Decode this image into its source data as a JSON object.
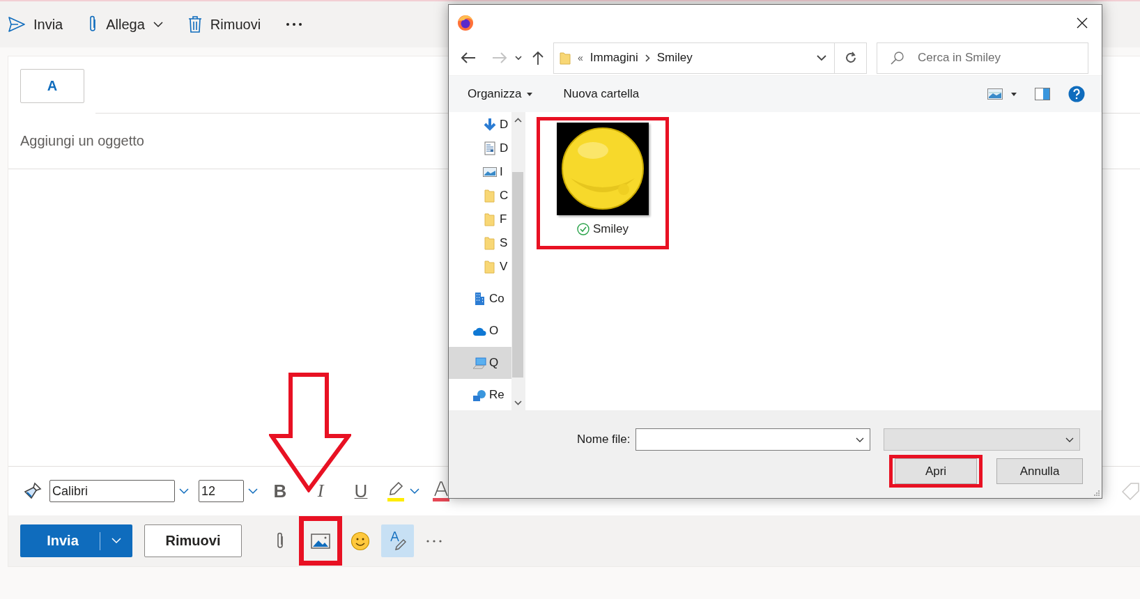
{
  "toolbar": [
    {
      "kind": "send",
      "label": "Invia",
      "has_menu": false
    },
    {
      "kind": "attach",
      "label": "Allega",
      "has_menu": true
    },
    {
      "kind": "discard",
      "label": "Rimuovi",
      "has_menu": false
    },
    {
      "kind": "more",
      "has_menu": false
    }
  ],
  "recipients": {
    "to_button": "A"
  },
  "subject": {
    "placeholder": "Aggiungi un oggetto"
  },
  "format_bar": {
    "font": "Calibri",
    "size": "12",
    "styles": [
      {
        "kind": "bold",
        "glyph": "B"
      },
      {
        "kind": "italic",
        "glyph": "I"
      },
      {
        "kind": "underline",
        "glyph": "U"
      }
    ]
  },
  "send_bar": {
    "send": "Invia",
    "discard": "Rimuovi",
    "insert_picture_marked": true,
    "editor_active": true
  },
  "dialog": {
    "location": {
      "overflow": "«",
      "path": [
        "Immagini",
        "Smiley"
      ]
    },
    "search": {
      "placeholder": "Cerca in Smiley"
    },
    "commands": [
      {
        "kind": "menu",
        "label": "Organizza"
      },
      {
        "kind": "action",
        "label": "Nuova cartella"
      }
    ],
    "quick_access": [
      {
        "kind": "download",
        "label": "D",
        "selected": false
      },
      {
        "kind": "document",
        "label": "D",
        "selected": false
      },
      {
        "kind": "pictures",
        "label": "I",
        "selected": false
      },
      {
        "kind": "folder",
        "label": "C",
        "selected": false
      },
      {
        "kind": "folder",
        "label": "F",
        "selected": false
      },
      {
        "kind": "folder",
        "label": "S",
        "selected": false
      },
      {
        "kind": "folder",
        "label": "V",
        "selected": false
      }
    ],
    "locations": [
      {
        "kind": "building",
        "label": "Co",
        "selected": false
      },
      {
        "kind": "cloud",
        "label": "O",
        "selected": false
      },
      {
        "kind": "computer",
        "label": "Q",
        "selected": true
      },
      {
        "kind": "network",
        "label": "Re",
        "selected": false
      }
    ],
    "files": [
      {
        "name": "Smiley",
        "kind": "picture",
        "synced": true,
        "marked": true
      }
    ],
    "file_name": {
      "label": "Nome file:"
    },
    "buttons": [
      {
        "label": "Apri",
        "marked": true
      },
      {
        "label": "Annulla",
        "marked": false
      }
    ]
  }
}
